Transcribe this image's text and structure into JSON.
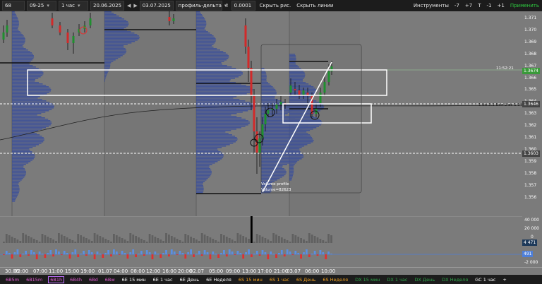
{
  "toolbar": {
    "symbol": "68",
    "contract": "09-25",
    "interval": "1 час",
    "date_from": "20.06.2025",
    "date_to": "03.07.2025",
    "profile": "профиль-дельта",
    "tick": "0.0001",
    "hide_chart": "Скрыть рис.",
    "hide_lines": "Скрыть линии",
    "instruments": "Инструменты",
    "minus7": "-7",
    "plus7": "+7",
    "t": "T",
    "minus1": "-1",
    "plus1": "+1",
    "apply": "Применить"
  },
  "price_axis": {
    "ticks": [
      "1.371",
      "1.370",
      "1.369",
      "1.368",
      "1.367",
      "1.366",
      "1.365",
      "1.364",
      "1.363",
      "1.362",
      "1.361",
      "1.360",
      "1.359",
      "1.358",
      "1.357",
      "1.356"
    ],
    "current_price": "1.3674",
    "current_time": "11:52:21",
    "level_upper": "1.3646",
    "level_lower": "1.3603"
  },
  "chart_notes": {
    "volume_profile": "Volume profile",
    "volume_value": "Volume=82623",
    "level_text": "1 бн 3.1 Бол 2 вс 1.3%"
  },
  "lower_axis": {
    "ticks": [
      "40 000",
      "20 000",
      "0",
      "-2 000"
    ],
    "volume_tag": "4 471",
    "delta_tag": "491"
  },
  "time_axis": {
    "labels": [
      "30.06",
      "03:00",
      "07:00",
      "11:00",
      "15:00",
      "19:00",
      "01.07",
      "04:00",
      "08:00",
      "12:00",
      "16:00",
      "20:00",
      "02.07",
      "05:00",
      "09:00",
      "13:00",
      "17:00",
      "21:00",
      "03.07",
      "06:00",
      "10:00"
    ]
  },
  "tabs": [
    {
      "label": "6B5m",
      "color": "#e05bd0",
      "selected": false
    },
    {
      "label": "6B15m",
      "color": "#e05bd0",
      "selected": false
    },
    {
      "label": "6B1h",
      "color": "#e05bd0",
      "selected": true
    },
    {
      "label": "6B4h",
      "color": "#e05bd0",
      "selected": false
    },
    {
      "label": "6Bd",
      "color": "#e05bd0",
      "selected": false
    },
    {
      "label": "6Bw",
      "color": "#e05bd0",
      "selected": false
    },
    {
      "label": "6E 15 мин",
      "color": "#ffffff",
      "selected": false
    },
    {
      "label": "6E 1 час",
      "color": "#ffffff",
      "selected": false
    },
    {
      "label": "6E День",
      "color": "#ffffff",
      "selected": false
    },
    {
      "label": "6E Неделя",
      "color": "#ffffff",
      "selected": false
    },
    {
      "label": "6S 15 мин",
      "color": "#f0a020",
      "selected": false
    },
    {
      "label": "6S 1 час",
      "color": "#f0a020",
      "selected": false
    },
    {
      "label": "6S День",
      "color": "#f0a020",
      "selected": false
    },
    {
      "label": "6S Неделя",
      "color": "#f0a020",
      "selected": false
    },
    {
      "label": "DX 15 мин",
      "color": "#2ea84a",
      "selected": false
    },
    {
      "label": "DX 1 час",
      "color": "#2ea84a",
      "selected": false
    },
    {
      "label": "DX День",
      "color": "#2ea84a",
      "selected": false
    },
    {
      "label": "DX Неделя",
      "color": "#2ea84a",
      "selected": false
    },
    {
      "label": "GC 1 час",
      "color": "#ffffff",
      "selected": false
    },
    {
      "label": "+",
      "color": "#ffffff",
      "selected": false
    }
  ]
}
